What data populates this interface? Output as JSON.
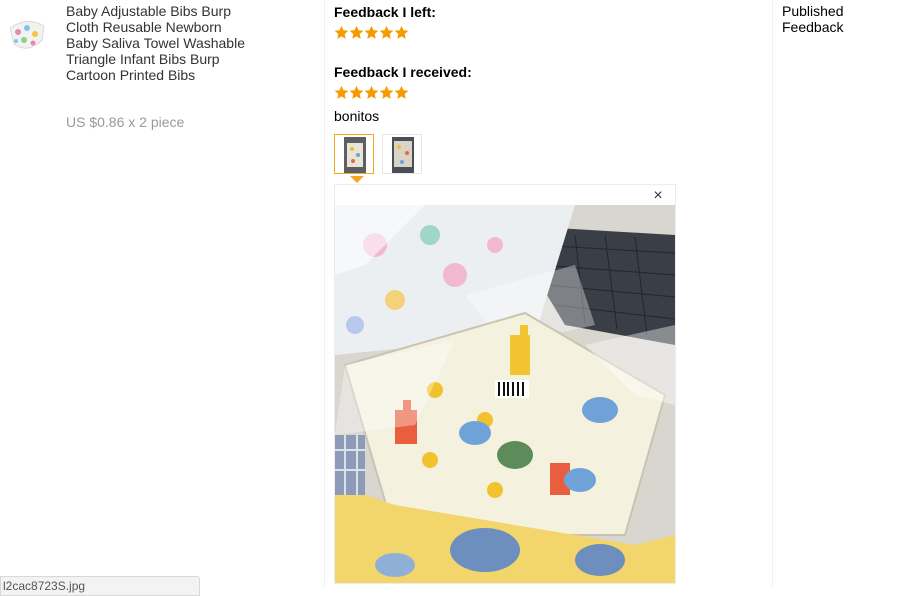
{
  "product": {
    "title": "Baby Adjustable Bibs Burp Cloth Reusable Newborn Baby Saliva Towel Washable Triangle Infant Bibs Burp Cartoon Printed Bibs",
    "price_line": "US $0.86 x 2 piece",
    "thumbnail_icon": "bib-product-image"
  },
  "feedback": {
    "left_label": "Feedback I left:",
    "left_stars": 5,
    "received_label": "Feedback I received:",
    "received_stars": 5,
    "comment": "bonitos",
    "photos_count": 2,
    "selected_photo": 1
  },
  "status": {
    "published_label": "Published Feedback"
  },
  "browser_status": {
    "url_text": "l2cac8723S.jpg"
  },
  "colors": {
    "star": "#f59b00",
    "active_border": "#f5a623"
  }
}
